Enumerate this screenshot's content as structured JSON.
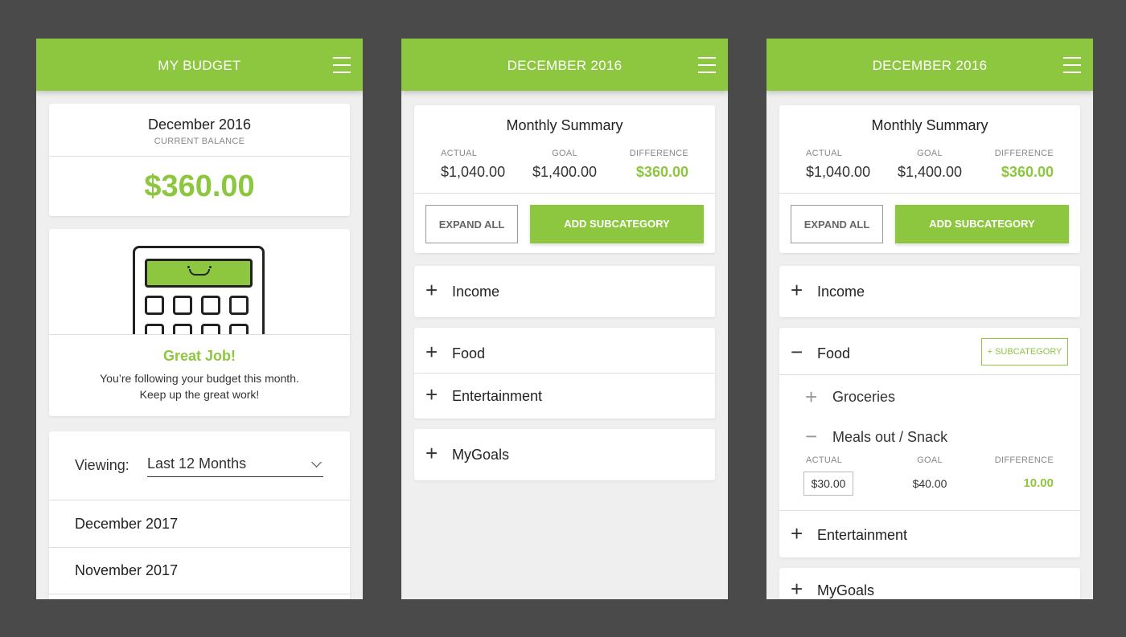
{
  "colors": {
    "accent": "#8dc63f",
    "background": "#4a4a4a",
    "navy": "#243f73"
  },
  "screen1": {
    "title": "MY BUDGET",
    "menu_icon": "hamburger-icon",
    "balance": {
      "month": "December 2016",
      "label": "CURRENT BALANCE",
      "amount": "$360.00"
    },
    "message": {
      "heading": "Great Job!",
      "line1": "You’re following your budget this month.",
      "line2": "Keep up the great work!"
    },
    "viewing": {
      "label": "Viewing:",
      "selected": "Last 12 Months"
    },
    "months": [
      "December 2017",
      "November 2017"
    ]
  },
  "screen2": {
    "title": "DECEMBER 2016",
    "summary": {
      "heading": "Monthly Summary",
      "actual_label": "ACTUAL",
      "actual_value": "$1,040.00",
      "goal_label": "GOAL",
      "goal_value": "$1,400.00",
      "difference_label": "DIFFERENCE",
      "difference_value": "$360.00"
    },
    "expand_all": "EXPAND ALL",
    "add_subcategory": "ADD SUBCATEGORY",
    "categories": [
      "Income",
      "Food",
      "Entertainment"
    ],
    "goals": "MyGoals",
    "plus_sign": "+"
  },
  "screen3": {
    "title": "DECEMBER 2016",
    "summary": {
      "heading": "Monthly Summary",
      "actual_label": "ACTUAL",
      "actual_value": "$1,040.00",
      "goal_label": "GOAL",
      "goal_value": "$1,400.00",
      "difference_label": "DIFFERENCE",
      "difference_value": "$360.00"
    },
    "expand_all": "EXPAND ALL",
    "add_subcategory": "ADD SUBCATEGORY",
    "income": "Income",
    "food": "Food",
    "subcategory_button": "+ SUBCATEGORY",
    "groceries": "Groceries",
    "meals": "Meals out / Snack",
    "meals_detail": {
      "actual_label": "ACTUAL",
      "actual_value": "$30.00",
      "goal_label": "GOAL",
      "goal_value": "$40.00",
      "difference_label": "DIFFERENCE",
      "difference_value": "10.00"
    },
    "entertainment": "Entertainment",
    "goals": "MyGoals",
    "plus_sign": "+",
    "minus_sign": "−"
  }
}
